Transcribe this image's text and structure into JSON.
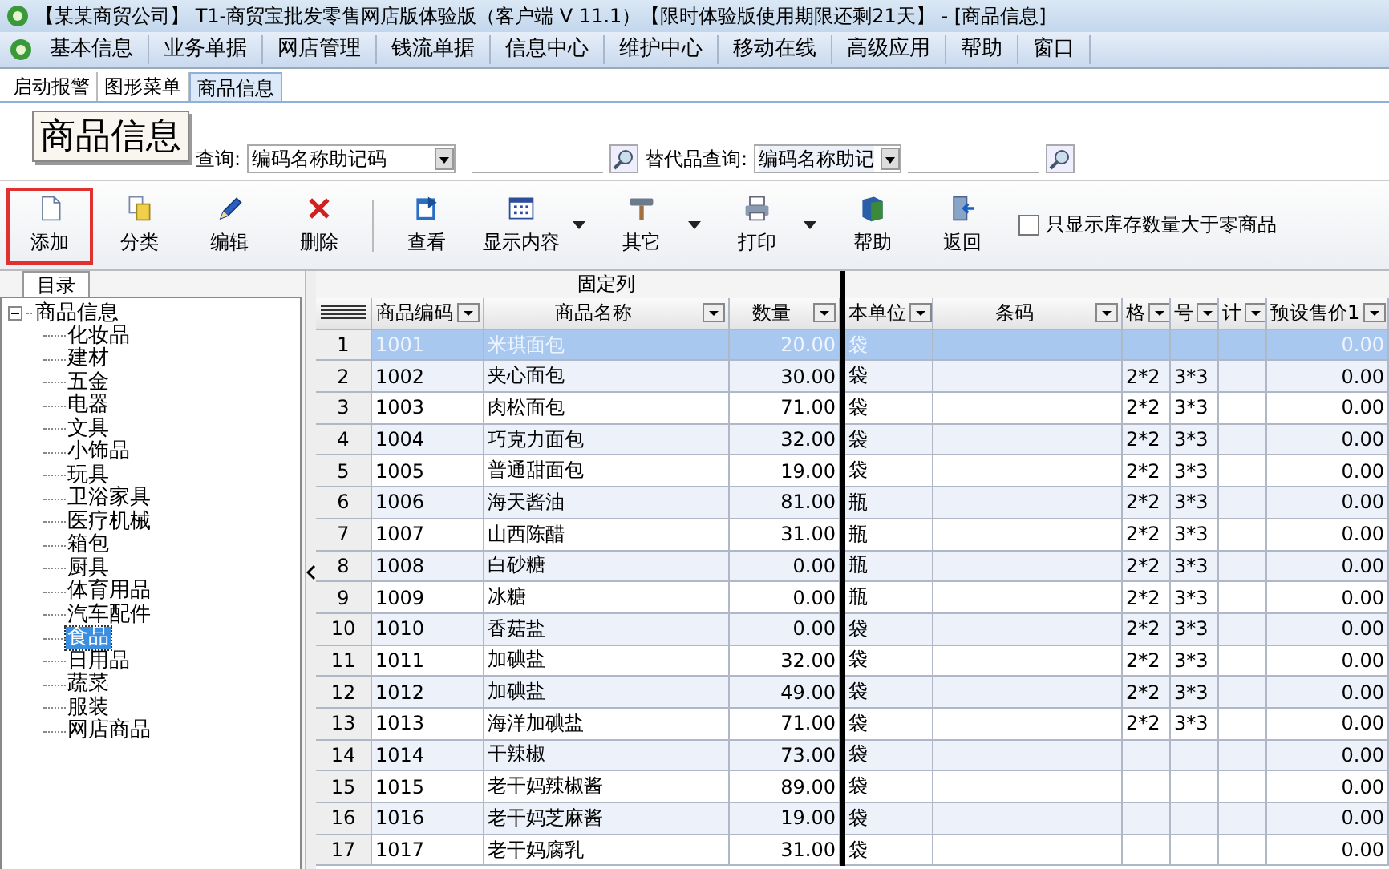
{
  "window": {
    "title": "【某某商贸公司】 T1-商贸宝批发零售网店版体验版（客户端 V 11.1）【限时体验版使用期限还剩21天】 - [商品信息]"
  },
  "menu": [
    "基本信息",
    "业务单据",
    "网店管理",
    "钱流单据",
    "信息中心",
    "维护中心",
    "移动在线",
    "高级应用",
    "帮助",
    "窗口"
  ],
  "tabs": [
    {
      "label": "启动报警",
      "selected": false
    },
    {
      "label": "图形菜单",
      "selected": false
    },
    {
      "label": "商品信息",
      "selected": true
    }
  ],
  "header": {
    "title": "商品信息",
    "query_label": "查询:",
    "query_mode": "编码名称助记码",
    "alt_query_label": "替代品查询:",
    "alt_query_mode": "编码名称助记"
  },
  "toolbar": [
    {
      "kind": "add",
      "label": "添加",
      "dropdown": false,
      "highlighted": true
    },
    {
      "kind": "category",
      "label": "分类",
      "dropdown": false,
      "highlighted": false
    },
    {
      "kind": "edit",
      "label": "编辑",
      "dropdown": false,
      "highlighted": false
    },
    {
      "kind": "delete",
      "label": "删除",
      "dropdown": false,
      "highlighted": false
    },
    {
      "kind": "view",
      "label": "查看",
      "dropdown": false,
      "highlighted": false
    },
    {
      "kind": "display",
      "label": "显示内容",
      "dropdown": true,
      "highlighted": false
    },
    {
      "kind": "other",
      "label": "其它",
      "dropdown": true,
      "highlighted": false
    },
    {
      "kind": "print",
      "label": "打印",
      "dropdown": true,
      "highlighted": false
    },
    {
      "kind": "help",
      "label": "帮助",
      "dropdown": false,
      "highlighted": false
    },
    {
      "kind": "back",
      "label": "返回",
      "dropdown": false,
      "highlighted": false
    }
  ],
  "stock_filter": {
    "label": "只显示库存数量大于零商品",
    "checked": false
  },
  "tree": {
    "tab": "目录",
    "root": {
      "label": "商品信息",
      "expanded": true,
      "children": [
        {
          "label": "化妆品",
          "selected": false
        },
        {
          "label": "建材",
          "selected": false
        },
        {
          "label": "五金",
          "selected": false
        },
        {
          "label": "电器",
          "selected": false
        },
        {
          "label": "文具",
          "selected": false
        },
        {
          "label": "小饰品",
          "selected": false
        },
        {
          "label": "玩具",
          "selected": false
        },
        {
          "label": "卫浴家具",
          "selected": false
        },
        {
          "label": "医疗机械",
          "selected": false
        },
        {
          "label": "箱包",
          "selected": false
        },
        {
          "label": "厨具",
          "selected": false
        },
        {
          "label": "体育用品",
          "selected": false
        },
        {
          "label": "汽车配件",
          "selected": false
        },
        {
          "label": "食品",
          "selected": true
        },
        {
          "label": "日用品",
          "selected": false
        },
        {
          "label": "蔬菜",
          "selected": false
        },
        {
          "label": "服装",
          "selected": false
        },
        {
          "label": "网店商品",
          "selected": false
        }
      ]
    }
  },
  "table": {
    "fixed_band": "固定列",
    "columns": [
      "商品编码",
      "商品名称",
      "数量",
      "本单位",
      "条码",
      "格",
      "号",
      "计",
      "预设售价1"
    ],
    "rows": [
      {
        "n": "1",
        "code": "1001",
        "name": "米琪面包",
        "qty": "20.00",
        "unit": "袋",
        "c5": "",
        "c6": "",
        "price": "0.00",
        "selected": true
      },
      {
        "n": "2",
        "code": "1002",
        "name": "夹心面包",
        "qty": "30.00",
        "unit": "袋",
        "c5": "2*2",
        "c6": "3*3",
        "price": "0.00",
        "selected": false
      },
      {
        "n": "3",
        "code": "1003",
        "name": "肉松面包",
        "qty": "71.00",
        "unit": "袋",
        "c5": "2*2",
        "c6": "3*3",
        "price": "0.00",
        "selected": false
      },
      {
        "n": "4",
        "code": "1004",
        "name": "巧克力面包",
        "qty": "32.00",
        "unit": "袋",
        "c5": "2*2",
        "c6": "3*3",
        "price": "0.00",
        "selected": false
      },
      {
        "n": "5",
        "code": "1005",
        "name": "普通甜面包",
        "qty": "19.00",
        "unit": "袋",
        "c5": "2*2",
        "c6": "3*3",
        "price": "0.00",
        "selected": false
      },
      {
        "n": "6",
        "code": "1006",
        "name": "海天酱油",
        "qty": "81.00",
        "unit": "瓶",
        "c5": "2*2",
        "c6": "3*3",
        "price": "0.00",
        "selected": false
      },
      {
        "n": "7",
        "code": "1007",
        "name": "山西陈醋",
        "qty": "31.00",
        "unit": "瓶",
        "c5": "2*2",
        "c6": "3*3",
        "price": "0.00",
        "selected": false
      },
      {
        "n": "8",
        "code": "1008",
        "name": "白砂糖",
        "qty": "0.00",
        "unit": "瓶",
        "c5": "2*2",
        "c6": "3*3",
        "price": "0.00",
        "selected": false
      },
      {
        "n": "9",
        "code": "1009",
        "name": "冰糖",
        "qty": "0.00",
        "unit": "瓶",
        "c5": "2*2",
        "c6": "3*3",
        "price": "0.00",
        "selected": false
      },
      {
        "n": "10",
        "code": "1010",
        "name": "香菇盐",
        "qty": "0.00",
        "unit": "袋",
        "c5": "2*2",
        "c6": "3*3",
        "price": "0.00",
        "selected": false
      },
      {
        "n": "11",
        "code": "1011",
        "name": "加碘盐",
        "qty": "32.00",
        "unit": "袋",
        "c5": "2*2",
        "c6": "3*3",
        "price": "0.00",
        "selected": false
      },
      {
        "n": "12",
        "code": "1012",
        "name": "加碘盐",
        "qty": "49.00",
        "unit": "袋",
        "c5": "2*2",
        "c6": "3*3",
        "price": "0.00",
        "selected": false
      },
      {
        "n": "13",
        "code": "1013",
        "name": "海洋加碘盐",
        "qty": "71.00",
        "unit": "袋",
        "c5": "2*2",
        "c6": "3*3",
        "price": "0.00",
        "selected": false
      },
      {
        "n": "14",
        "code": "1014",
        "name": "干辣椒",
        "qty": "73.00",
        "unit": "袋",
        "c5": "",
        "c6": "",
        "price": "0.00",
        "selected": false
      },
      {
        "n": "15",
        "code": "1015",
        "name": "老干妈辣椒酱",
        "qty": "89.00",
        "unit": "袋",
        "c5": "",
        "c6": "",
        "price": "0.00",
        "selected": false
      },
      {
        "n": "16",
        "code": "1016",
        "name": "老干妈芝麻酱",
        "qty": "19.00",
        "unit": "袋",
        "c5": "",
        "c6": "",
        "price": "0.00",
        "selected": false
      },
      {
        "n": "17",
        "code": "1017",
        "name": "老干妈腐乳",
        "qty": "31.00",
        "unit": "袋",
        "c5": "",
        "c6": "",
        "price": "0.00",
        "selected": false
      }
    ]
  }
}
